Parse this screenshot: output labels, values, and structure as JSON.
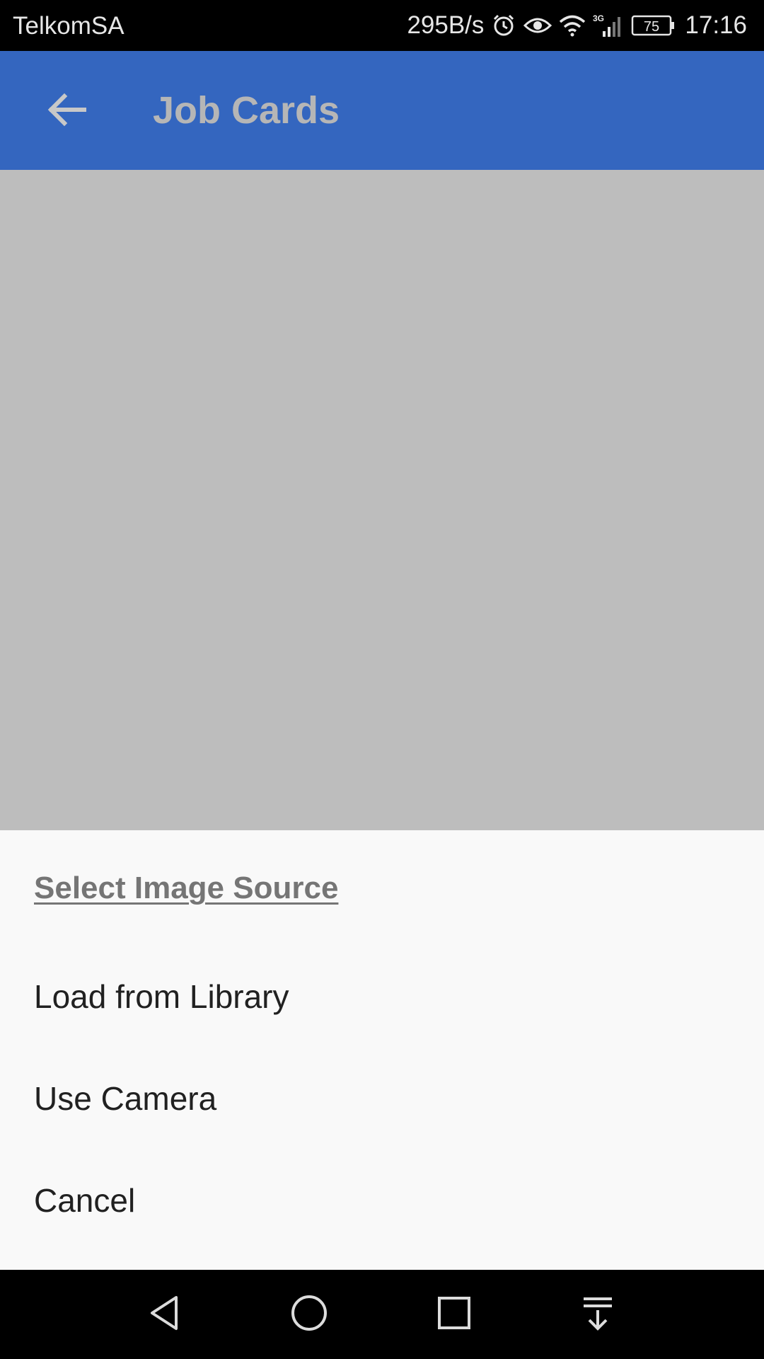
{
  "status_bar": {
    "carrier": "TelkomSA",
    "net_speed": "295B/s",
    "network_type": "3G",
    "battery": "75",
    "time": "17:16",
    "icons": [
      "alarm-icon",
      "eye-icon",
      "wifi-icon",
      "signal-icon",
      "battery-icon"
    ]
  },
  "app_bar": {
    "back_icon": "arrow-left-icon",
    "title": "Job Cards",
    "color": "#3466bf"
  },
  "sheet": {
    "title": "Select Image Source",
    "options": [
      {
        "label": "Load from Library"
      },
      {
        "label": "Use Camera"
      },
      {
        "label": "Cancel"
      }
    ]
  },
  "nav_bar": {
    "icons": [
      "triangle-back-icon",
      "circle-home-icon",
      "square-recents-icon",
      "notification-pull-icon"
    ]
  }
}
